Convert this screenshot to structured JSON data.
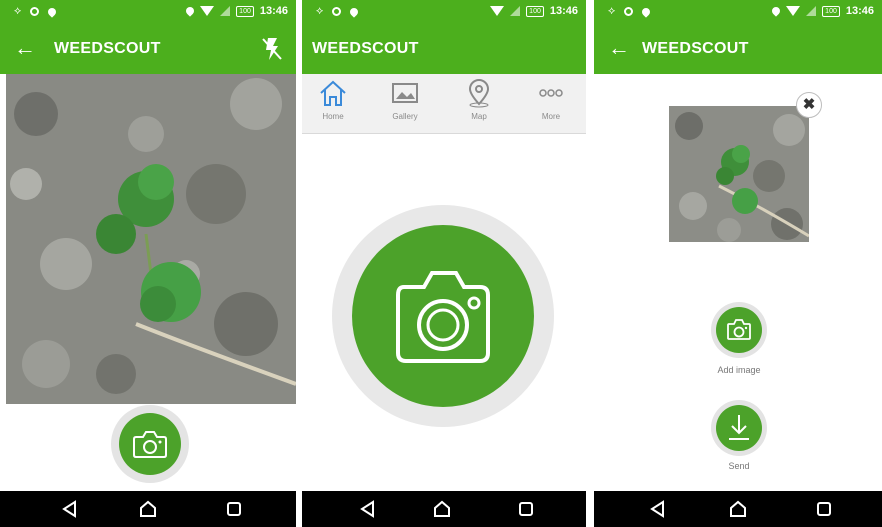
{
  "status_bar": {
    "time": "13:46",
    "battery": "100"
  },
  "app": {
    "title": "WEEDSCOUT"
  },
  "menu": {
    "items": [
      {
        "label": "Home",
        "icon": "home-icon"
      },
      {
        "label": "Gallery",
        "icon": "gallery-icon"
      },
      {
        "label": "Map",
        "icon": "map-pin-icon"
      },
      {
        "label": "More",
        "icon": "more-dots-icon"
      }
    ]
  },
  "actions": {
    "add_image_label": "Add image",
    "send_label": "Send"
  },
  "icons": {
    "back": "arrow-left-icon",
    "flash": "flash-off-icon",
    "camera": "camera-icon",
    "remove": "close-icon",
    "send": "download-arrow-icon",
    "nav_back": "triangle-back-icon",
    "nav_home": "home-outline-icon",
    "nav_recent": "square-recent-icon"
  },
  "colors": {
    "brand_green": "#4caf1d",
    "button_green": "#4ca22a",
    "nav_bar": "#000000",
    "menu_grey": "#8a8a8a"
  }
}
